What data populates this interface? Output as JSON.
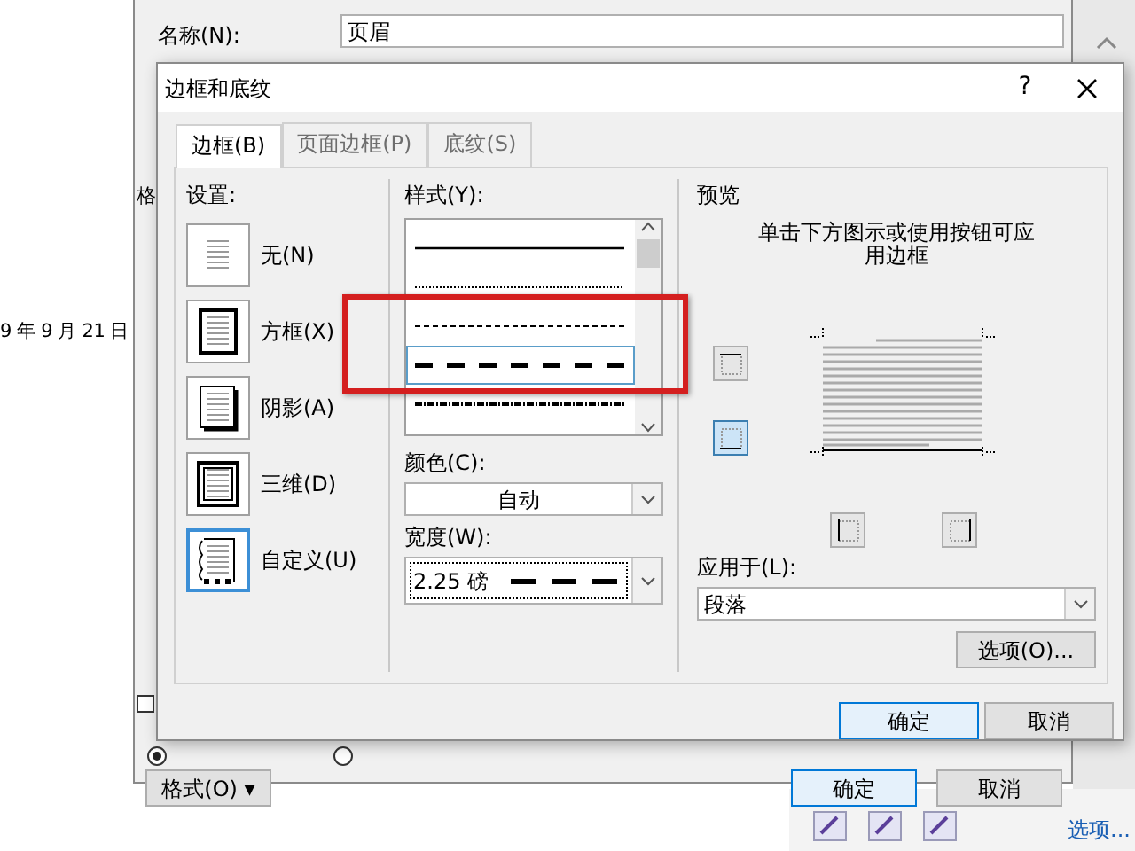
{
  "document": {
    "date_text": "9 年 9 月 21 日",
    "side_link": "选项..."
  },
  "style_dialog": {
    "name_label": "名称(N):",
    "name_value": "页眉",
    "format_label": "格",
    "checkbox": {
      "checked": false
    },
    "radios": [
      {
        "selected": true
      },
      {
        "selected": false
      }
    ],
    "format_button": "格式(O) ▾",
    "ok_button": "确定",
    "cancel_button": "取消"
  },
  "dialog": {
    "title": "边框和底纹",
    "help": "?",
    "tabs": [
      {
        "label": "边框(B)",
        "selected": true
      },
      {
        "label": "页面边框(P)",
        "selected": false
      },
      {
        "label": "底纹(S)",
        "selected": false
      }
    ],
    "settings": {
      "label": "设置:",
      "items": [
        {
          "label": "无(N)",
          "kind": "none",
          "selected": false
        },
        {
          "label": "方框(X)",
          "kind": "box",
          "selected": false
        },
        {
          "label": "阴影(A)",
          "kind": "shadow",
          "selected": false
        },
        {
          "label": "三维(D)",
          "kind": "three-d",
          "selected": false
        },
        {
          "label": "自定义(U)",
          "kind": "custom",
          "selected": true
        }
      ]
    },
    "style": {
      "label": "样式(Y):",
      "lines": [
        {
          "kind": "solid",
          "selected": false
        },
        {
          "kind": "dotted",
          "selected": false
        },
        {
          "kind": "small-dash",
          "selected": false
        },
        {
          "kind": "dash",
          "selected": true
        },
        {
          "kind": "dash-dot",
          "selected": false
        }
      ]
    },
    "color": {
      "label": "颜色(C):",
      "value": "自动"
    },
    "width": {
      "label": "宽度(W):",
      "value": "2.25 磅"
    },
    "preview": {
      "label": "预览",
      "hint": "单击下方图示或使用按钮可应用边框",
      "border_buttons": [
        {
          "kind": "top",
          "selected": false
        },
        {
          "kind": "bottom",
          "selected": true
        },
        {
          "kind": "left",
          "selected": false
        },
        {
          "kind": "right",
          "selected": false
        }
      ]
    },
    "apply_to": {
      "label": "应用于(L):",
      "value": "段落"
    },
    "options_button": "选项(O)...",
    "ok_button": "确定",
    "cancel_button": "取消"
  }
}
